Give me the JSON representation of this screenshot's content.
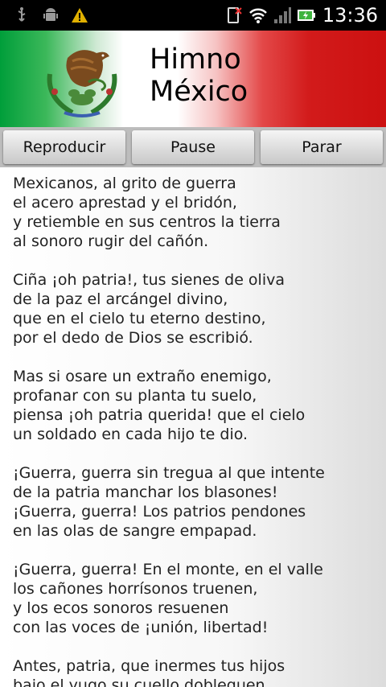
{
  "status_bar": {
    "time": "13:36",
    "left_icons": [
      "usb-icon",
      "android-icon",
      "warning-icon"
    ],
    "right_icons": [
      "notification-icon",
      "wifi-icon",
      "signal-icon",
      "battery-charging-icon"
    ]
  },
  "header": {
    "title_line1": "Himno",
    "title_line2": "México",
    "emblem": "mexican-eagle-emblem",
    "colors": {
      "green": "#009e3a",
      "white": "#ffffff",
      "red": "#cc1010"
    }
  },
  "buttons": {
    "play": "Reproducir",
    "pause": "Pause",
    "stop": "Parar"
  },
  "lyrics": {
    "stanzas": [
      [
        "Mexicanos, al grito de guerra",
        "el acero aprestad y el bridón,",
        "y retiemble en sus centros la tierra",
        "al sonoro rugir del cañón."
      ],
      [
        "Ciña ¡oh patria!, tus sienes de oliva",
        "de la paz el arcángel divino,",
        "que en el cielo tu eterno destino,",
        "por el dedo de Dios se escribió."
      ],
      [
        "Mas si osare un extraño enemigo,",
        "profanar con su planta tu suelo,",
        "piensa ¡oh patria querida! que el cielo",
        "un soldado en cada hijo te dio."
      ],
      [
        "¡Guerra, guerra sin tregua al que intente",
        "de la patria manchar los blasones!",
        "¡Guerra, guerra! Los patrios pendones",
        "en las olas de sangre empapad."
      ],
      [
        "¡Guerra, guerra! En el monte, en el valle",
        "los cañones horrísonos truenen,",
        "y los ecos sonoros resuenen",
        "con las voces de ¡unión, libertad!"
      ],
      [
        "Antes, patria, que inermes tus hijos",
        "bajo el yugo su cuello dobleguen,"
      ]
    ]
  }
}
